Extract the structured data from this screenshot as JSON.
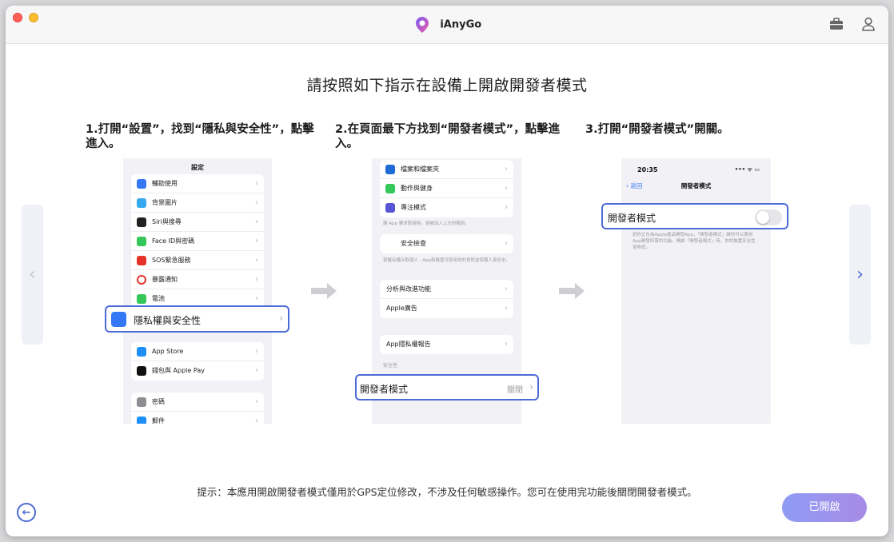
{
  "app": {
    "name": "iAnyGo"
  },
  "heading": "請按照如下指示在設備上開啟開發者模式",
  "steps": [
    {
      "title": "1.打開“設置”，找到“隱私與安全性”，點擊進入。"
    },
    {
      "title": "2.在頁面最下方找到“開發者模式”，點擊進入。"
    },
    {
      "title": "3.打開“開發者模式”開關。"
    }
  ],
  "phone1": {
    "title": "設定",
    "group1": [
      "輔助使用",
      "背景圖片",
      "Siri與搜尋",
      "Face ID與密碼",
      "SOS緊急服務",
      "暴露通知",
      "電池"
    ],
    "highlight": "隱私權與安全性",
    "group2": [
      "App Store",
      "錢包與 Apple Pay"
    ],
    "group3": [
      "密碼",
      "郵件"
    ]
  },
  "phone2": {
    "group1": [
      "檔案和檔案夾",
      "動作與健身",
      "專注模式"
    ],
    "note1": "讓 App 要求取用時，會被加入上方的類別。",
    "safety": "安全檢查",
    "note2": "掌握有權存取個人 · App和裝置可取用你的資訊並保護人身安全。",
    "group3": [
      "分析與改進功能",
      "Apple廣告"
    ],
    "report": "App隱私權報告",
    "section": "安全性",
    "highlight": "開發者模式",
    "highlight_value": "關閉"
  },
  "phone3": {
    "time": "20:35",
    "back": "返回",
    "title": "開發者模式",
    "highlight": "開發者模式",
    "note": "若你正在為Apple產品開發App，「開發者模式」讓你可以使用App開發所需的功能。開啟「開發者模式」時，你的裝置安全性會降低。"
  },
  "tip": "提示：本應用開啟開發者模式僅用於GPS定位修改，不涉及任何敏感操作。您可在使用完功能後關閉開發者模式。",
  "buttons": {
    "enabled": "已開啟"
  }
}
